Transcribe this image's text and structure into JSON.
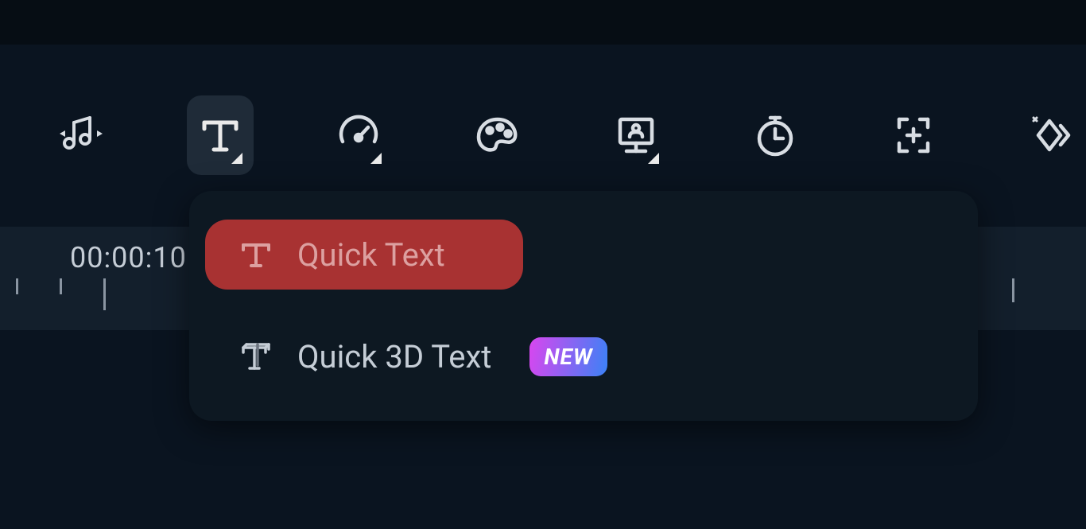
{
  "timeline": {
    "time_display": "00:00:10"
  },
  "toolbar": {
    "buttons": [
      {
        "name": "audio-icon"
      },
      {
        "name": "text-icon",
        "active": true
      },
      {
        "name": "speed-icon"
      },
      {
        "name": "color-icon"
      },
      {
        "name": "pip-icon"
      },
      {
        "name": "timer-icon"
      },
      {
        "name": "add-marker-icon"
      },
      {
        "name": "effects-icon"
      }
    ]
  },
  "text_menu": {
    "items": [
      {
        "label": "Quick Text",
        "highlighted": true,
        "badge": null
      },
      {
        "label": "Quick 3D Text",
        "highlighted": false,
        "badge": "NEW"
      }
    ]
  }
}
